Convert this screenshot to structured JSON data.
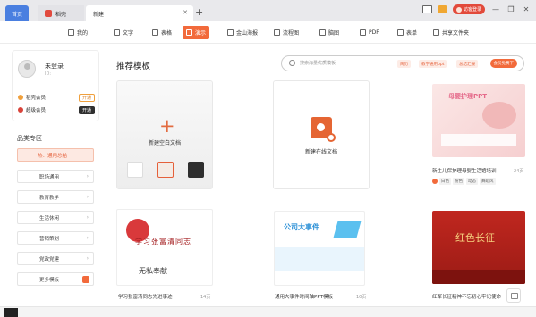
{
  "titlebar": {
    "tabs": [
      {
        "label": "首页"
      },
      {
        "label": "稻壳"
      },
      {
        "label": "新建"
      }
    ],
    "add_tab": "+",
    "login_button": "访客登录",
    "window_controls": [
      "—",
      "❐",
      "✕"
    ]
  },
  "toolbar": {
    "items": [
      {
        "label": "我的"
      },
      {
        "label": "文字"
      },
      {
        "label": "表格"
      },
      {
        "label": "演示"
      },
      {
        "label": "金山海报"
      },
      {
        "label": "流程图"
      },
      {
        "label": "脑图"
      },
      {
        "label": "PDF"
      },
      {
        "label": "表单"
      },
      {
        "label": "共享文件夹"
      }
    ],
    "active_index": 3
  },
  "sidebar": {
    "user": {
      "name": "未登录",
      "id": "ID:"
    },
    "memberships": [
      {
        "label": "稻壳会员",
        "action": "开通"
      },
      {
        "label": "超级会员",
        "action": "开通"
      }
    ],
    "categories_title": "品类专区",
    "categories": [
      {
        "label": "热：通用总结"
      },
      {
        "label": "职场通用"
      },
      {
        "label": "教育教学"
      },
      {
        "label": "生活休闲"
      },
      {
        "label": "营销策划"
      },
      {
        "label": "党政党建"
      },
      {
        "label": "更多模板"
      }
    ]
  },
  "main": {
    "title": "推荐模板",
    "search": {
      "placeholder": "搜索海量优质模板",
      "chips": [
        "简历",
        "教学通用ppt",
        "总结汇报"
      ],
      "vip_button": "会员免费下"
    },
    "blank_card": {
      "label": "新建空白文档"
    },
    "online_card": {
      "label": "新建在线文档"
    },
    "templates": [
      {
        "title": "新生儿保护理母婴生活馆培训",
        "pages": "24页",
        "tags": [
          "白色",
          "粉色",
          "动态",
          "舞蹈风"
        ],
        "thumb_heading": "母婴护理PPT"
      },
      {
        "title": "学习张富清同志先进事迹",
        "pages": "14页",
        "thumb_heading": "学习张富清同志",
        "thumb_sub": "无私奉献"
      },
      {
        "title": "通用大事件时间轴PPT模板",
        "pages": "10页",
        "thumb_heading": "公司大事件"
      },
      {
        "title": "红军长征精神不忘初心牢记使命",
        "pages": "",
        "thumb_heading": "红色长征"
      }
    ]
  },
  "colors": {
    "accent": "#f26a3b",
    "home_tab": "#4a7fe0",
    "login": "#e24a3b"
  }
}
